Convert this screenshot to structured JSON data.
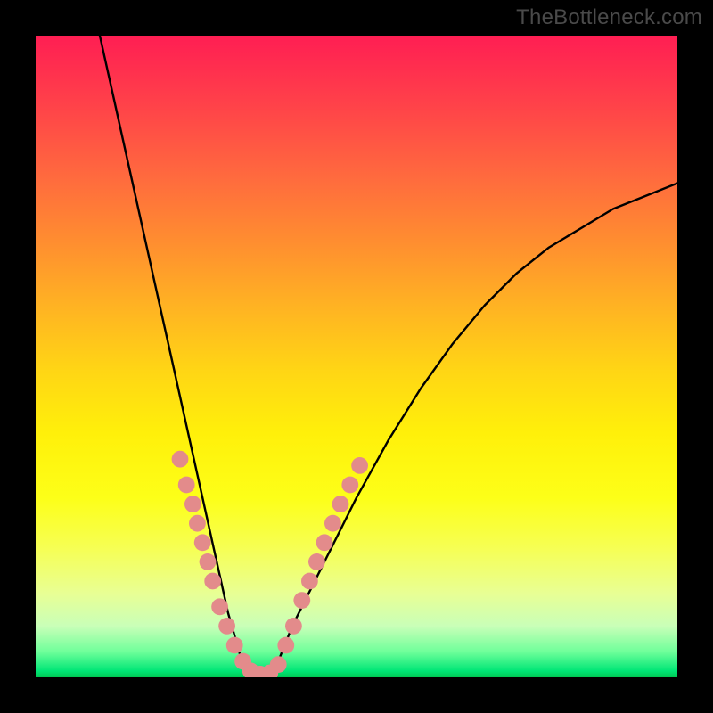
{
  "watermark": "TheBottleneck.com",
  "chart_data": {
    "type": "line",
    "title": "",
    "xlabel": "",
    "ylabel": "",
    "xlim": [
      0,
      100
    ],
    "ylim": [
      0,
      100
    ],
    "grid": false,
    "legend": false,
    "background_gradient": {
      "orientation": "vertical",
      "stops": [
        {
          "pos": 0,
          "color": "#ff1e53"
        },
        {
          "pos": 50,
          "color": "#ffd515"
        },
        {
          "pos": 80,
          "color": "#f6ff55"
        },
        {
          "pos": 96,
          "color": "#6fff9a"
        },
        {
          "pos": 100,
          "color": "#00c853"
        }
      ]
    },
    "series": [
      {
        "name": "bottleneck-curve",
        "color": "#000000",
        "x": [
          10,
          12,
          14,
          16,
          18,
          20,
          22,
          24,
          26,
          28,
          30,
          32,
          34,
          36,
          38,
          40,
          45,
          50,
          55,
          60,
          65,
          70,
          75,
          80,
          85,
          90,
          95,
          100
        ],
        "y": [
          100,
          91,
          82,
          73,
          64,
          55,
          46,
          37,
          28,
          19,
          10,
          3,
          0,
          0,
          3,
          8,
          18,
          28,
          37,
          45,
          52,
          58,
          63,
          67,
          70,
          73,
          75,
          77
        ]
      }
    ],
    "markers": {
      "color": "#e38b8b",
      "radius": 1.3,
      "points": [
        {
          "x": 22.5,
          "y": 34
        },
        {
          "x": 23.5,
          "y": 30
        },
        {
          "x": 24.5,
          "y": 27
        },
        {
          "x": 25.2,
          "y": 24
        },
        {
          "x": 26.0,
          "y": 21
        },
        {
          "x": 26.8,
          "y": 18
        },
        {
          "x": 27.6,
          "y": 15
        },
        {
          "x": 28.7,
          "y": 11
        },
        {
          "x": 29.8,
          "y": 8
        },
        {
          "x": 31.0,
          "y": 5
        },
        {
          "x": 32.3,
          "y": 2.5
        },
        {
          "x": 33.5,
          "y": 1
        },
        {
          "x": 35.0,
          "y": 0.5
        },
        {
          "x": 36.5,
          "y": 0.7
        },
        {
          "x": 37.8,
          "y": 2
        },
        {
          "x": 39.0,
          "y": 5
        },
        {
          "x": 40.2,
          "y": 8
        },
        {
          "x": 41.5,
          "y": 12
        },
        {
          "x": 42.7,
          "y": 15
        },
        {
          "x": 43.8,
          "y": 18
        },
        {
          "x": 45.0,
          "y": 21
        },
        {
          "x": 46.3,
          "y": 24
        },
        {
          "x": 47.5,
          "y": 27
        },
        {
          "x": 49.0,
          "y": 30
        },
        {
          "x": 50.5,
          "y": 33
        }
      ]
    }
  }
}
